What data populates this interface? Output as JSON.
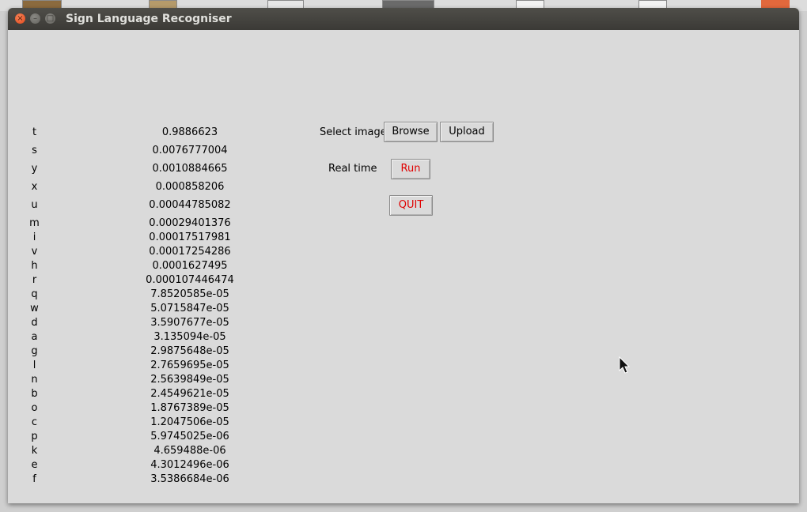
{
  "window": {
    "title": "Sign Language Recogniser"
  },
  "predictions": [
    {
      "letter": "t",
      "value": "0.9886623"
    },
    {
      "letter": "s",
      "value": "0.0076777004"
    },
    {
      "letter": "y",
      "value": "0.0010884665"
    },
    {
      "letter": "x",
      "value": "0.000858206"
    },
    {
      "letter": "u",
      "value": "0.00044785082"
    },
    {
      "letter": "m",
      "value": "0.00029401376"
    },
    {
      "letter": "i",
      "value": "0.00017517981"
    },
    {
      "letter": "v",
      "value": "0.00017254286"
    },
    {
      "letter": "h",
      "value": "0.0001627495"
    },
    {
      "letter": "r",
      "value": "0.000107446474"
    },
    {
      "letter": "q",
      "value": "7.8520585e-05"
    },
    {
      "letter": "w",
      "value": "5.0715847e-05"
    },
    {
      "letter": "d",
      "value": "3.5907677e-05"
    },
    {
      "letter": "a",
      "value": "3.135094e-05"
    },
    {
      "letter": "g",
      "value": "2.9875648e-05"
    },
    {
      "letter": "l",
      "value": "2.7659695e-05"
    },
    {
      "letter": "n",
      "value": "2.5639849e-05"
    },
    {
      "letter": "b",
      "value": "2.4549621e-05"
    },
    {
      "letter": "o",
      "value": "1.8767389e-05"
    },
    {
      "letter": "c",
      "value": "1.2047506e-05"
    },
    {
      "letter": "p",
      "value": "5.9745025e-06"
    },
    {
      "letter": "k",
      "value": "4.659488e-06"
    },
    {
      "letter": "e",
      "value": "4.3012496e-06"
    },
    {
      "letter": "f",
      "value": "3.5386684e-06"
    }
  ],
  "controls": {
    "select_image_label": "Select image",
    "browse_label": "Browse",
    "upload_label": "Upload",
    "realtime_label": "Real time",
    "run_label": "Run",
    "quit_label": "QUIT"
  },
  "colors": {
    "accent_red": "#e00000",
    "titlebar": "#3b3a36"
  }
}
